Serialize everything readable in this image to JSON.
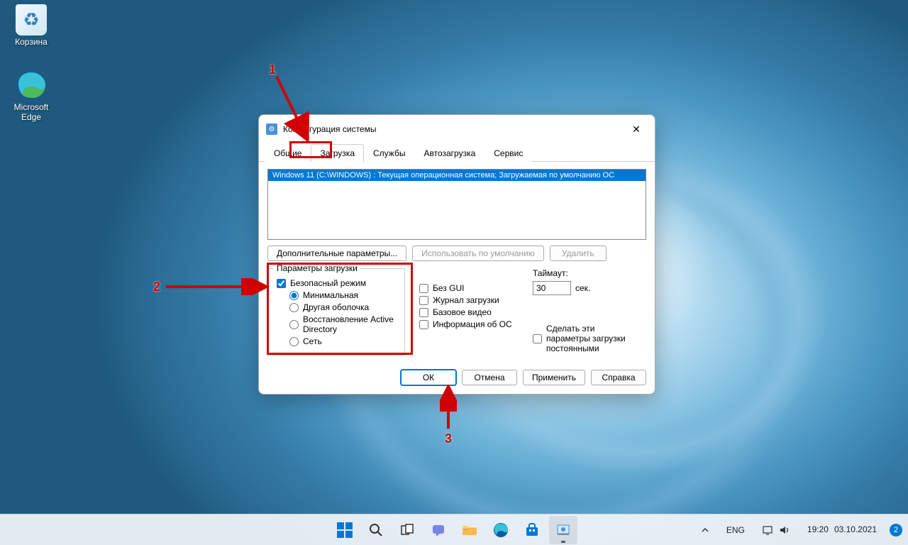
{
  "desktop": {
    "icons": [
      {
        "name": "recycle-bin",
        "label": "Корзина"
      },
      {
        "name": "edge",
        "label": "Microsoft Edge"
      }
    ]
  },
  "dialog": {
    "title": "Конфигурация системы",
    "tabs": [
      "Общие",
      "Загрузка",
      "Службы",
      "Автозагрузка",
      "Сервис"
    ],
    "active_tab": 1,
    "os_entry": "Windows 11 (C:\\WINDOWS) : Текущая операционная система; Загружаемая по умолчанию ОС",
    "buttons_mid": {
      "advanced": "Дополнительные параметры...",
      "default": "Использовать по умолчанию",
      "delete": "Удалить"
    },
    "boot_options": {
      "legend": "Параметры загрузки",
      "safe_boot": "Безопасный режим",
      "radios": [
        "Минимальная",
        "Другая оболочка",
        "Восстановление Active Directory",
        "Сеть"
      ],
      "col2": [
        "Без GUI",
        "Журнал загрузки",
        "Базовое видео",
        "Информация  об ОС"
      ]
    },
    "timeout": {
      "label": "Таймаут:",
      "value": "30",
      "unit": "сек."
    },
    "permanent": "Сделать эти параметры загрузки постоянными",
    "footer": {
      "ok": "ОК",
      "cancel": "Отмена",
      "apply": "Применить",
      "help": "Справка"
    }
  },
  "annotations": {
    "n1": "1",
    "n2": "2",
    "n3": "3"
  },
  "taskbar": {
    "lang": "ENG",
    "time": "19:20",
    "date": "03.10.2021",
    "notif_count": "2"
  }
}
